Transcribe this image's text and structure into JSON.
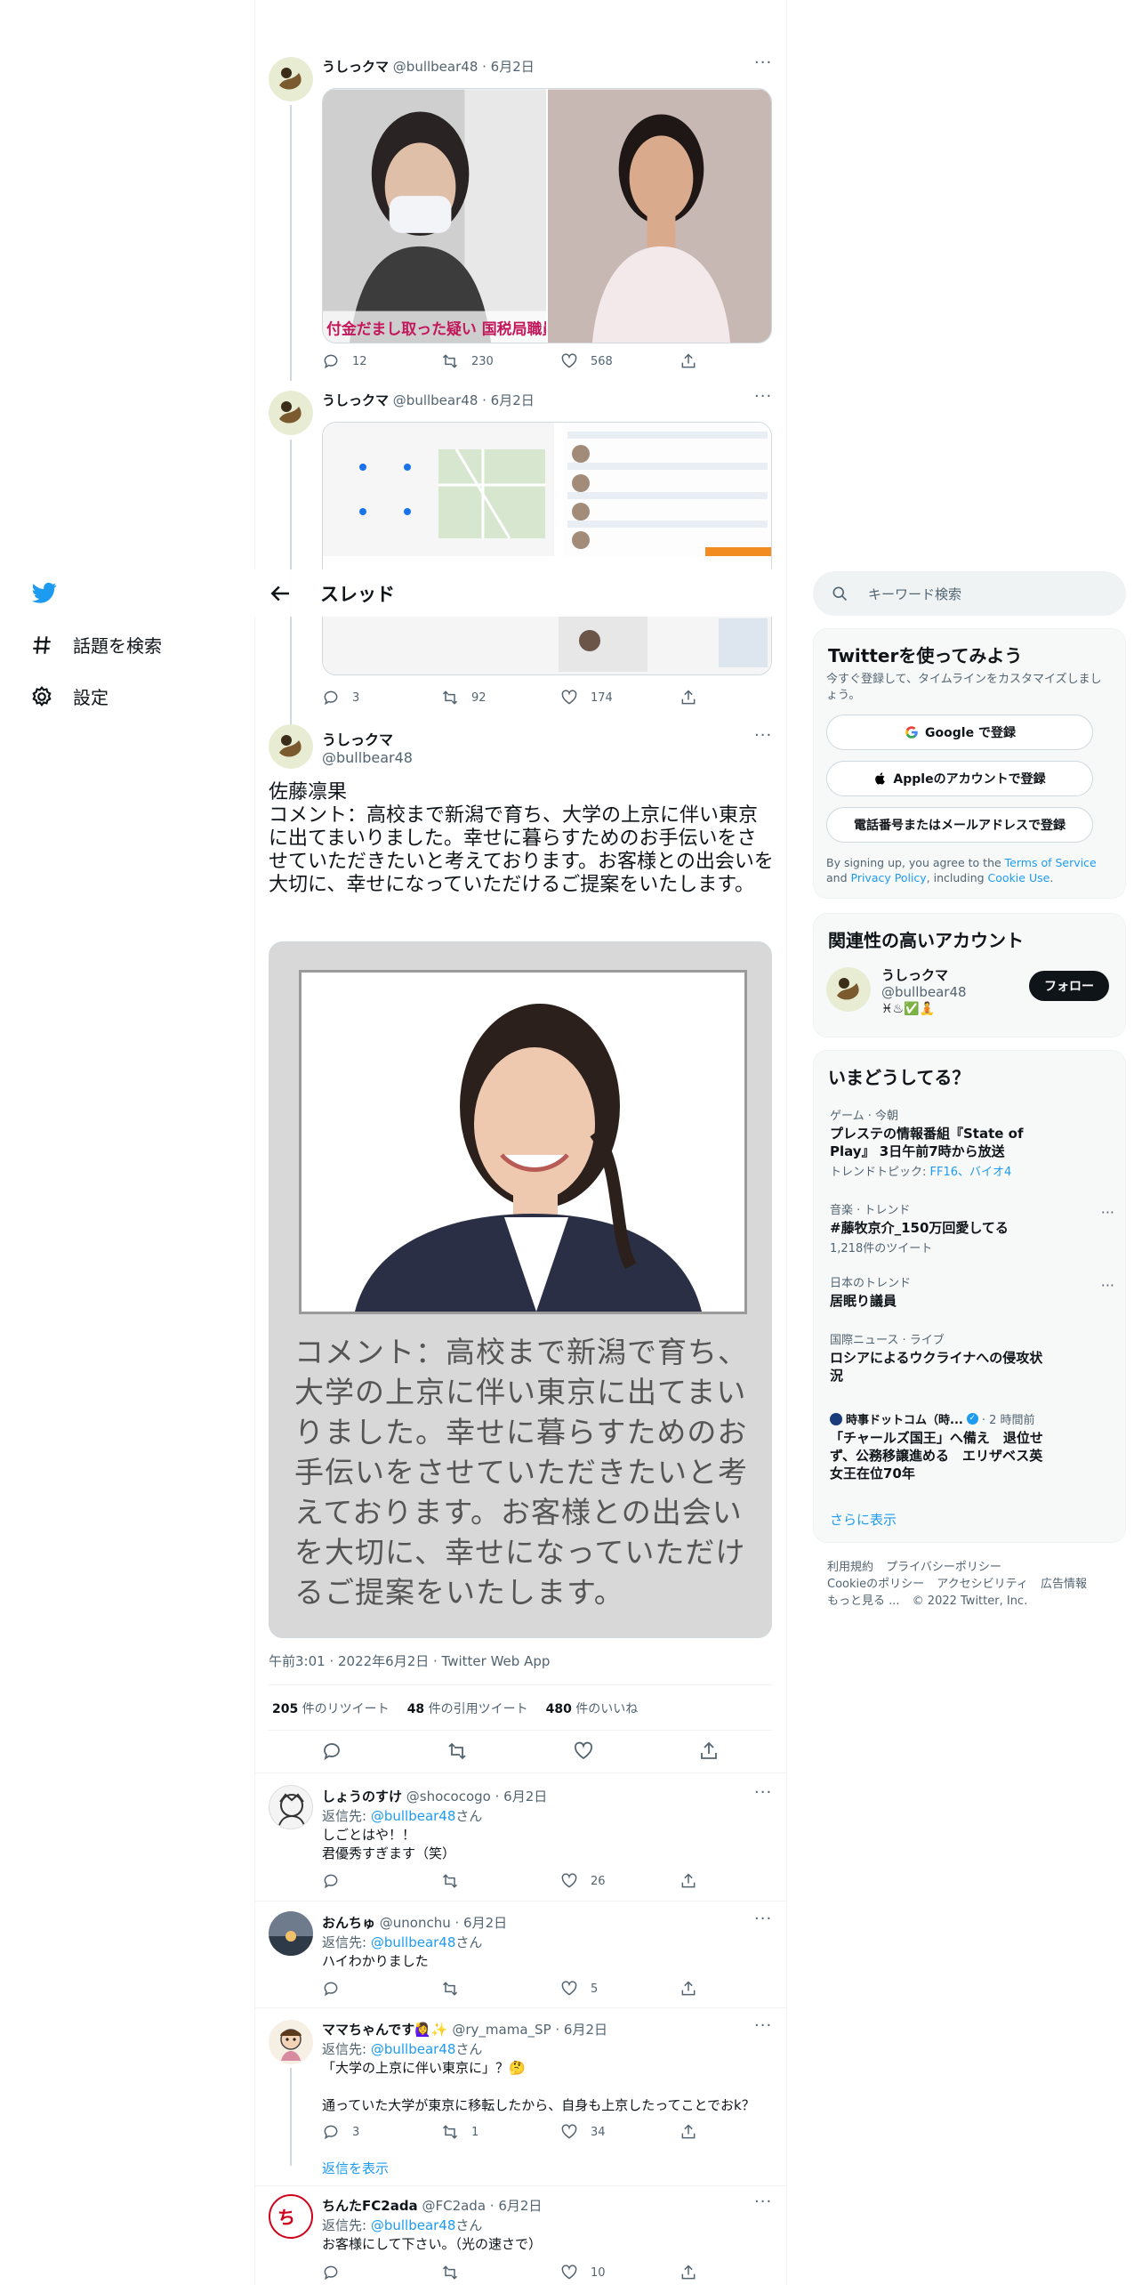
{
  "nav": {
    "explore_label": "話題を検索",
    "settings_label": "設定"
  },
  "header": {
    "title": "スレッド"
  },
  "tweet1": {
    "name": "うしっクマ",
    "handle": "@bullbear48 · 6月2日",
    "photo_caption": "付金だまし取った疑い 国税局職員",
    "replies": "12",
    "retweets": "230",
    "likes": "568"
  },
  "tweet2": {
    "name": "うしっクマ",
    "handle": "@bullbear48 · 6月2日",
    "replies": "3",
    "retweets": "92",
    "likes": "174"
  },
  "main": {
    "name": "うしっクマ",
    "handle": "@bullbear48",
    "text": "佐藤凛果\nコメント：高校まで新潟で育ち、大学の上京に伴い東京に出てまいりました。幸せに暮らすためのお手伝いをさせていただきたいと考えております。お客様との出会いを大切に、幸せになっていただけるご提案をいたします。",
    "image_caption": "コメント：高校まで新潟で育ち、\n大学の上京に伴い東京に出てまい\nりました。幸せに暮らすためのお\n手伝いをさせていただきたいと考\nえております。お客様との出会い\nを大切に、幸せになっていただけ\nるご提案をいたします。",
    "meta": "午前3:01 · 2022年6月2日 · Twitter Web App",
    "retweets_num": "205",
    "retweets_label": " 件のリツイート",
    "quotes_num": "48",
    "quotes_label": " 件の引用ツイート",
    "likes_num": "480",
    "likes_label": " 件のいいね"
  },
  "replies": [
    {
      "name": "しょうのすけ",
      "handle": "@shococogo · 6月2日",
      "reply_prefix": "返信先: ",
      "reply_user": "@bullbear48",
      "reply_suffix": "さん",
      "text": "しごとはや！！\n君優秀すぎます（笑）",
      "replies": "",
      "retweets": "",
      "likes": "26"
    },
    {
      "name": "おんちゅ",
      "handle": "@unonchu · 6月2日",
      "reply_prefix": "返信先: ",
      "reply_user": "@bullbear48",
      "reply_suffix": "さん",
      "text": "ハイわかりました",
      "replies": "",
      "retweets": "",
      "likes": "5"
    },
    {
      "name": "ママちゃんです🙋‍♀️✨",
      "handle": "@ry_mama_SP · 6月2日",
      "reply_prefix": "返信先: ",
      "reply_user": "@bullbear48",
      "reply_suffix": "さん",
      "text": "「大学の上京に伴い東京に」？🤔\n\n通っていた大学が東京に移転したから、自身も上京したってことでおk？",
      "replies": "3",
      "retweets": "1",
      "likes": "34",
      "show_replies": "返信を表示"
    },
    {
      "name": "ちんたFC2ada",
      "handle": "@FC2ada · 6月2日",
      "reply_prefix": "返信先: ",
      "reply_user": "@bullbear48",
      "reply_suffix": "さん",
      "text": "お客様にして下さい。（光の速さで）",
      "replies": "",
      "retweets": "",
      "likes": "10"
    }
  ],
  "search": {
    "placeholder": "キーワード検索"
  },
  "signup": {
    "title": "Twitterを使ってみよう",
    "desc": "今すぐ登録して、タイムラインをカスタマイズしましょう。",
    "google": "Google で登録",
    "apple": "Appleのアカウントで登録",
    "phone": "電話番号またはメールアドレスで登録",
    "terms_prefix": "By signing up, you agree to the ",
    "terms_link": "Terms of Service",
    "terms_mid": " and ",
    "privacy_link": "Privacy Policy",
    "terms_mid2": ", including ",
    "cookie_link": "Cookie Use",
    "terms_end": "."
  },
  "related": {
    "title": "関連性の高いアカウント",
    "name": "うしっクマ",
    "handle": "@bullbear48",
    "bio": "♓♨✅🧘",
    "follow": "フォロー"
  },
  "trends": {
    "title": "いまどうしてる？",
    "items": [
      {
        "cat": "ゲーム · 今朝",
        "name": "プレステの情報番組『State of Play』 3日午前7時から放送",
        "sub_prefix": "トレンドトピック: ",
        "sub_links": "FF16、バイオ4"
      },
      {
        "cat": "音楽 · トレンド",
        "name": "#藤牧京介_150万回愛してる",
        "sub": "1,218件のツイート"
      },
      {
        "cat": "日本のトレンド",
        "name": "居眠り議員"
      },
      {
        "cat": "国際ニュース · ライブ",
        "name": "ロシアによるウクライナへの侵攻状況"
      },
      {
        "cat_name": "時事ドットコム（時...",
        "cat_time": " · 2 時間前",
        "name": "「チャールズ国王」へ備え　退位せず、公務移譲進める　エリザベス英女王在位70年"
      }
    ],
    "more": "さらに表示"
  },
  "footer": {
    "links": [
      "利用規約",
      "プライバシーポリシー",
      "Cookieのポリシー",
      "アクセシビリティ",
      "広告情報",
      "もっと見る ...",
      "© 2022 Twitter, Inc."
    ]
  },
  "colors": {
    "accent": "#1d9bf0",
    "text": "#0f1419",
    "muted": "#536471",
    "border": "#eff3f4"
  }
}
